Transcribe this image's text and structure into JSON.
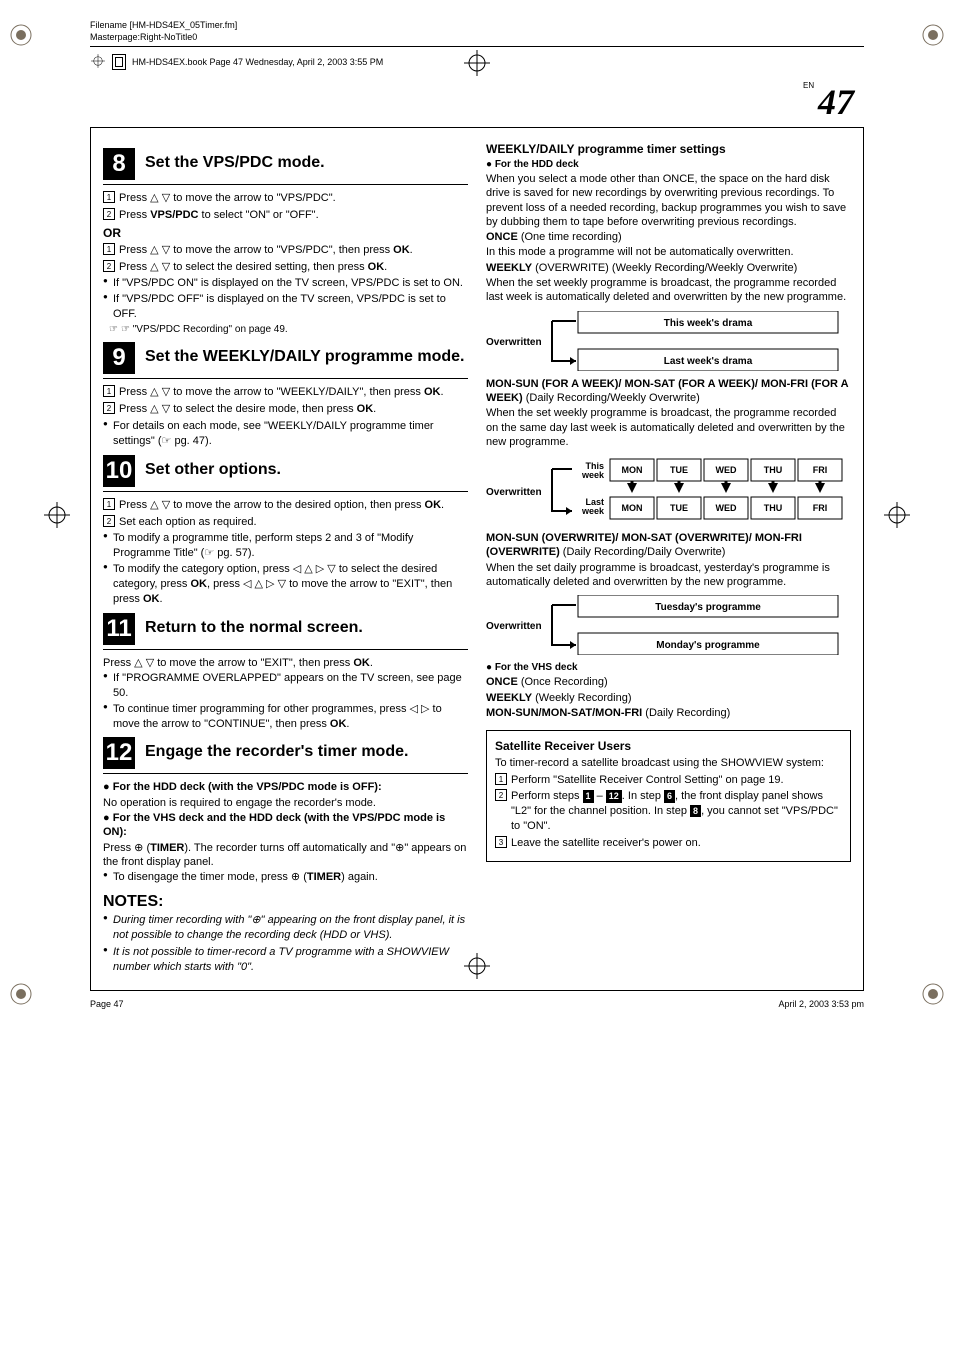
{
  "header": {
    "filename": "Filename [HM-HDS4EX_05Timer.fm]",
    "masterpage": "Masterpage:Right-NoTitle0",
    "bookline": "HM-HDS4EX.book  Page 47  Wednesday, April 2, 2003  3:55 PM"
  },
  "pagenum": {
    "en": "EN",
    "num": "47"
  },
  "steps": {
    "s8": {
      "num": "8",
      "title": "Set the VPS/PDC mode.",
      "a1": "Press △ ▽ to move the arrow to \"VPS/PDC\".",
      "a2_prefix": "Press ",
      "a2_bold": "VPS/PDC",
      "a2_suffix": " to select \"ON\" or \"OFF\".",
      "or": "OR",
      "b1_prefix": "Press △ ▽ to move the arrow to \"VPS/PDC\", then press ",
      "b1_bold": "OK",
      "b1_suffix": ".",
      "b2_prefix": "Press △ ▽ to select the desired setting, then press ",
      "b2_bold": "OK",
      "b2_suffix": ".",
      "bul1": "If \"VPS/PDC ON\" is displayed on the TV screen, VPS/PDC is set to ON.",
      "bul2": "If \"VPS/PDC OFF\" is displayed on the TV screen, VPS/PDC is set to OFF.",
      "ref": "☞ \"VPS/PDC Recording\" on page 49."
    },
    "s9": {
      "num": "9",
      "title": "Set the WEEKLY/DAILY programme mode.",
      "a1_prefix": "Press △ ▽ to move the arrow to \"WEEKLY/DAILY\", then press ",
      "a1_bold": "OK",
      "a1_suffix": ".",
      "a2_prefix": "Press △ ▽ to select the desire mode, then press ",
      "a2_bold": "OK",
      "a2_suffix": ".",
      "bul1": "For details on each mode, see \"WEEKLY/DAILY programme timer settings\" (☞ pg. 47)."
    },
    "s10": {
      "num": "10",
      "title": "Set other options.",
      "a1_prefix": "Press △ ▽ to move the arrow to the desired option, then press ",
      "a1_bold": "OK",
      "a1_suffix": ".",
      "a2": "Set each option as required.",
      "bul1": "To modify a programme title, perform steps 2 and 3 of \"Modify Programme Title\" (☞ pg. 57).",
      "bul2_prefix": "To modify the category option, press ◁ △ ▷ ▽ to select the desired category, press ",
      "bul2_bold1": "OK",
      "bul2_mid": ", press ◁ △ ▷ ▽ to move the arrow to \"EXIT\", then press ",
      "bul2_bold2": "OK",
      "bul2_suffix": "."
    },
    "s11": {
      "num": "11",
      "title": "Return to the normal screen.",
      "p1_prefix": "Press △ ▽ to move the arrow to \"EXIT\", then press ",
      "p1_bold": "OK",
      "p1_suffix": ".",
      "bul1": "If \"PROGRAMME OVERLAPPED\" appears on the TV screen, see page 50.",
      "bul2_prefix": "To continue timer programming for other programmes, press ◁ ▷ to move the arrow to \"CONTINUE\", then press ",
      "bul2_bold": "OK",
      "bul2_suffix": "."
    },
    "s12": {
      "num": "12",
      "title": "Engage the recorder's timer mode.",
      "h1": "For the HDD deck (with the VPS/PDC mode is OFF):",
      "p1": "No operation is required to engage the recorder's mode.",
      "h2": "For the VHS deck and the HDD deck (with the VPS/PDC mode is ON):",
      "p2_prefix": "Press ⊕ (",
      "p2_bold": "TIMER",
      "p2_mid": "). The recorder turns off automatically and \"⊕\" appears on the front display panel.",
      "bul1_prefix": "To disengage the timer mode, press ⊕ (",
      "bul1_bold": "TIMER",
      "bul1_suffix": ") again."
    },
    "notes": {
      "h": "NOTES:",
      "n1": "During timer recording with \"⊕\" appearing on the front display panel, it is not possible to change the recording deck (HDD or VHS).",
      "n2": "It is not possible to timer-record a TV programme with a SHOWVIEW number which starts with \"0\"."
    }
  },
  "right": {
    "h": "WEEKLY/DAILY programme timer settings",
    "sub1": "● For the HDD deck",
    "p1": "When you select a mode other than ONCE, the space on the hard disk drive is saved for new recordings by overwriting previous recordings. To prevent loss of a needed recording, backup programmes you wish to save by dubbing them to tape before overwriting previous recordings.",
    "once_h": "ONCE",
    "once_d": " (One time recording)",
    "once_p": "In this mode a programme will not be automatically overwritten.",
    "weekly_h": "WEEKLY",
    "weekly_paren": " (OVERWRITE)",
    "weekly_d": " (Weekly Recording/Weekly Overwrite)",
    "weekly_p": "When the set weekly programme is broadcast, the programme recorded last week is automatically deleted and overwritten by the new programme.",
    "diag1": {
      "overwritten": "Overwritten",
      "top": "This week's drama",
      "bottom": "Last week's drama"
    },
    "msmf_h": "MON-SUN (FOR A WEEK)/ MON-SAT (FOR A WEEK)/ MON-FRI (FOR A WEEK)",
    "msmf_d": " (Daily Recording/Weekly Overwrite)",
    "msmf_p": "When the set weekly programme is broadcast, the programme recorded on the same day last week is automatically deleted and overwritten by the new programme.",
    "diag2": {
      "overwritten": "Overwritten",
      "thisweek": "This week",
      "lastweek": "Last week",
      "days": [
        "MON",
        "TUE",
        "WED",
        "THU",
        "FRI"
      ]
    },
    "ow_h": "MON-SUN (OVERWRITE)/ MON-SAT (OVERWRITE)/ MON-FRI (OVERWRITE)",
    "ow_d": " (Daily Recording/Daily Overwrite)",
    "ow_p": "When the set daily programme is broadcast, yesterday's programme is automatically deleted and overwritten by the new programme.",
    "diag3": {
      "overwritten": "Overwritten",
      "top": "Tuesday's programme",
      "bottom": "Monday's programme"
    },
    "sub2": "● For the VHS deck",
    "vhs1_h": "ONCE",
    "vhs1_d": " (Once Recording)",
    "vhs2_h": "WEEKLY",
    "vhs2_d": " (Weekly Recording)",
    "vhs3_h": "MON-SUN/MON-SAT/MON-FRI",
    "vhs3_d": " (Daily Recording)"
  },
  "sat": {
    "h": "Satellite Receiver Users",
    "intro_prefix": "To timer-record a satellite broadcast using the S",
    "intro_sc": "HOW",
    "intro_mid": "V",
    "intro_sc2": "IEW",
    "intro_suffix": " system:",
    "s1": "Perform \"Satellite Receiver Control Setting\" on page 19.",
    "s2_prefix": "Perform steps ",
    "s2_a": "1",
    "s2_dash": " – ",
    "s2_b": "12",
    "s2_mid": ". In step ",
    "s2_c": "6",
    "s2_mid2": ", the front display panel shows \"L2\" for the channel position. In step ",
    "s2_d": "8",
    "s2_suffix": ", you cannot set \"VPS/PDC\" to \"ON\".",
    "s3": "Leave the satellite receiver's power on."
  },
  "footer": {
    "left": "Page 47",
    "right": "April 2, 2003 3:53 pm"
  }
}
